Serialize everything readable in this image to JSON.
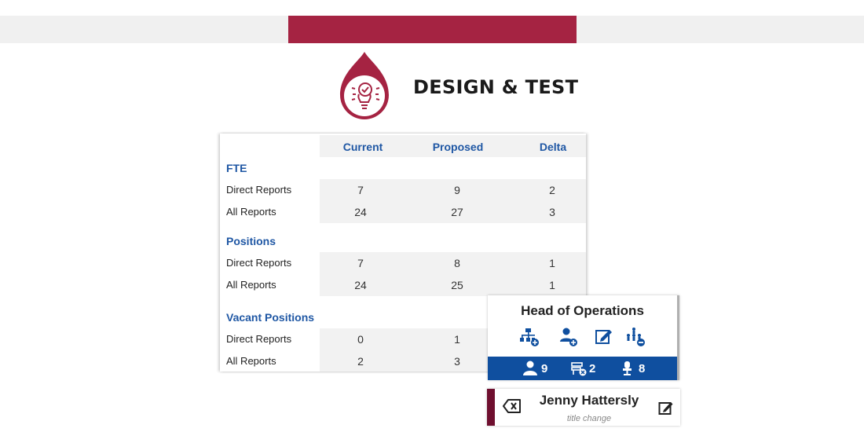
{
  "header": {
    "title": "DESIGN & TEST",
    "brand_color": "#a52342",
    "icon": "lightbulb-check-icon"
  },
  "table": {
    "columns": [
      "Current",
      "Proposed",
      "Delta"
    ],
    "sections": [
      {
        "title": "FTE",
        "rows": [
          {
            "label": "Direct Reports",
            "current": "7",
            "proposed": "9",
            "delta": "2"
          },
          {
            "label": "All Reports",
            "current": "24",
            "proposed": "27",
            "delta": "3"
          }
        ]
      },
      {
        "title": "Positions",
        "rows": [
          {
            "label": "Direct Reports",
            "current": "7",
            "proposed": "8",
            "delta": "1"
          },
          {
            "label": "All Reports",
            "current": "24",
            "proposed": "25",
            "delta": "1"
          }
        ]
      },
      {
        "title": "Vacant Positions",
        "rows": [
          {
            "label": "Direct Reports",
            "current": "0",
            "proposed": "1",
            "delta": ""
          },
          {
            "label": "All Reports",
            "current": "2",
            "proposed": "3",
            "delta": ""
          }
        ]
      }
    ]
  },
  "position_card": {
    "title": "Head of Operations",
    "actions": [
      "add-org-unit-icon",
      "add-person-icon",
      "edit-icon",
      "remove-team-icon"
    ],
    "stats": [
      {
        "icon": "person-icon",
        "value": "9"
      },
      {
        "icon": "vacant-desk-icon",
        "value": "2"
      },
      {
        "icon": "seat-icon",
        "value": "8"
      }
    ],
    "bar_color": "#0f4f9f"
  },
  "person_card": {
    "name": "Jenny Hattersly",
    "note": "title change",
    "accent_color": "#6f0f2f"
  }
}
